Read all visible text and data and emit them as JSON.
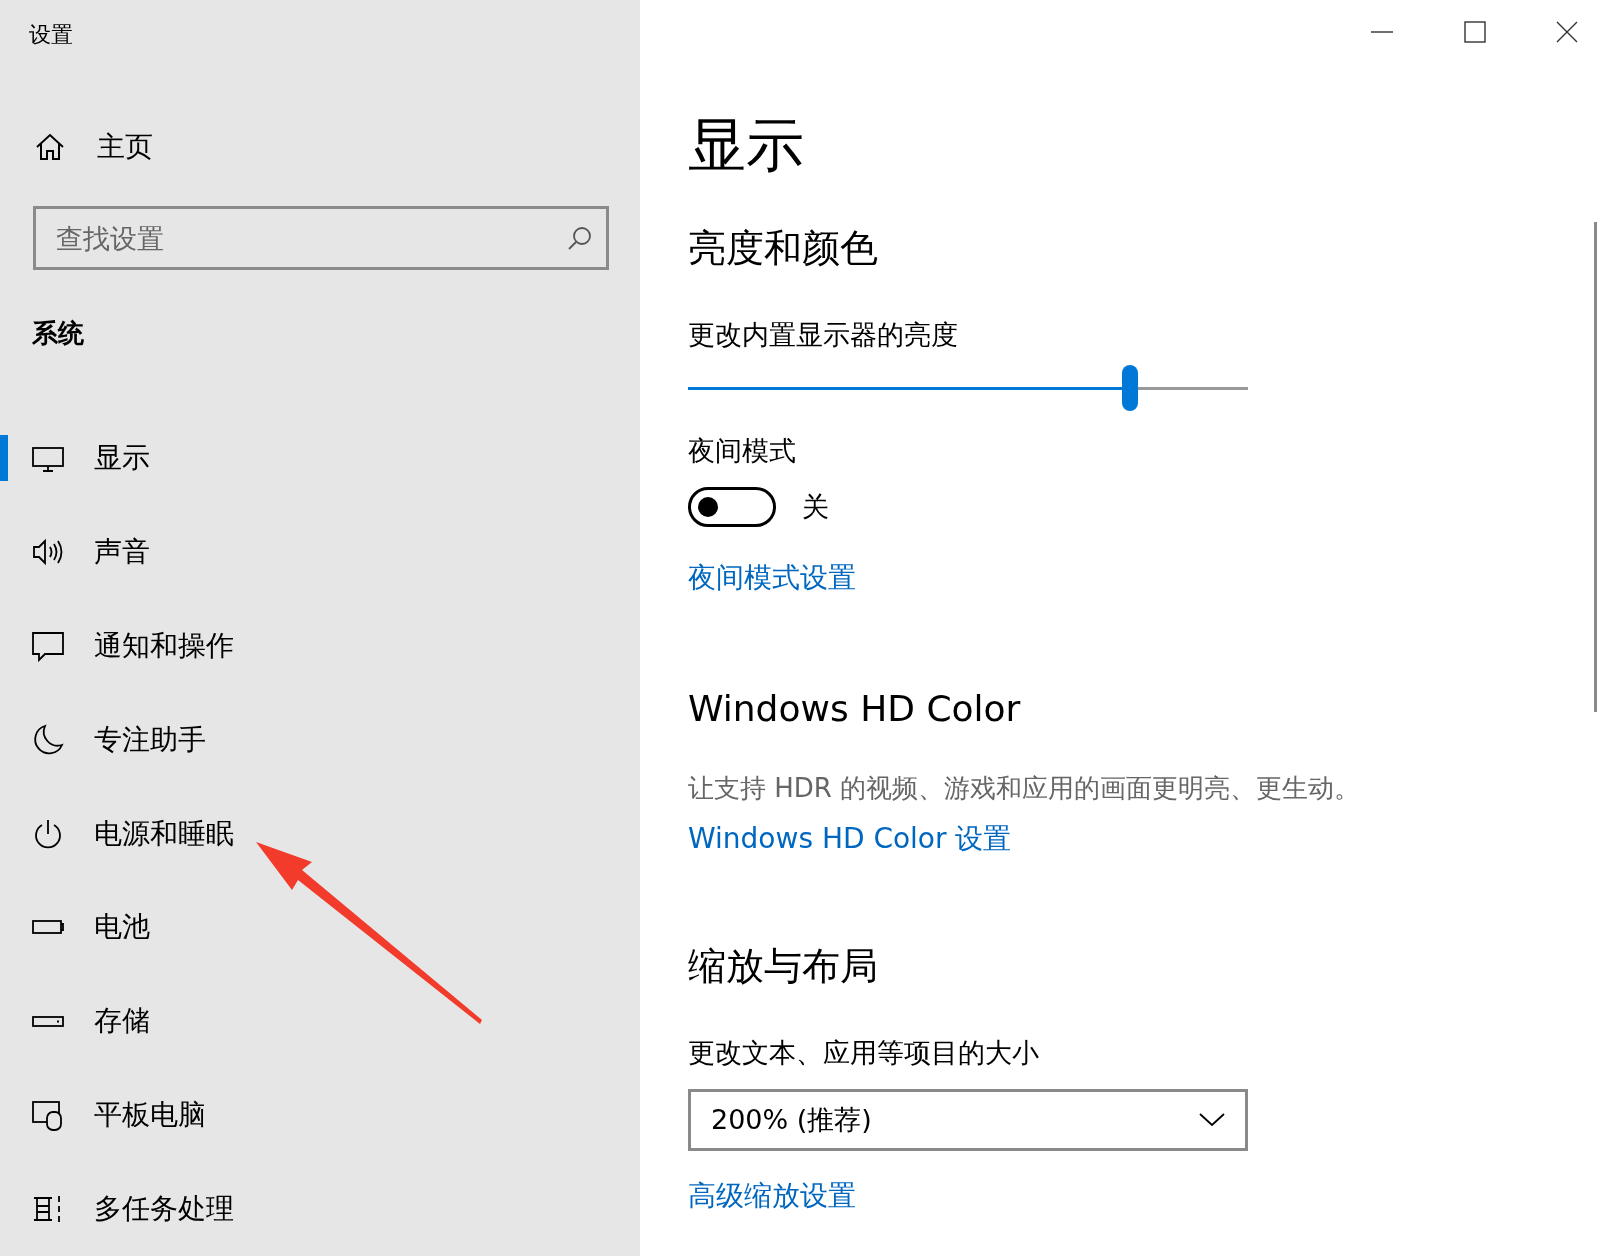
{
  "window": {
    "title": "设置"
  },
  "sidebar": {
    "home": {
      "label": "主页"
    },
    "search": {
      "placeholder": "查找设置"
    },
    "section": "系统",
    "items": [
      {
        "kind": "display",
        "label": "显示",
        "selected": true
      },
      {
        "kind": "sound",
        "label": "声音",
        "selected": false
      },
      {
        "kind": "notifications",
        "label": "通知和操作",
        "selected": false
      },
      {
        "kind": "focus",
        "label": "专注助手",
        "selected": false
      },
      {
        "kind": "power",
        "label": "电源和睡眠",
        "selected": false
      },
      {
        "kind": "battery",
        "label": "电池",
        "selected": false
      },
      {
        "kind": "storage",
        "label": "存储",
        "selected": false
      },
      {
        "kind": "tablet",
        "label": "平板电脑",
        "selected": false
      },
      {
        "kind": "multitasking",
        "label": "多任务处理",
        "selected": false
      }
    ]
  },
  "content": {
    "title": "显示",
    "brightness": {
      "heading": "亮度和颜色",
      "label": "更改内置显示器的亮度",
      "level": 0.79
    },
    "night_mode": {
      "label": "夜间模式",
      "on": false,
      "state_text": "关",
      "link": "夜间模式设置"
    },
    "hd_color": {
      "heading": "Windows HD Color",
      "description": "让支持 HDR 的视频、游戏和应用的画面更明亮、更生动。",
      "link": "Windows HD Color 设置"
    },
    "scale": {
      "heading": "缩放与布局",
      "label": "更改文本、应用等项目的大小",
      "value": "200% (推荐)",
      "link": "高级缩放设置"
    }
  },
  "annotation": {
    "kind": "arrow"
  }
}
